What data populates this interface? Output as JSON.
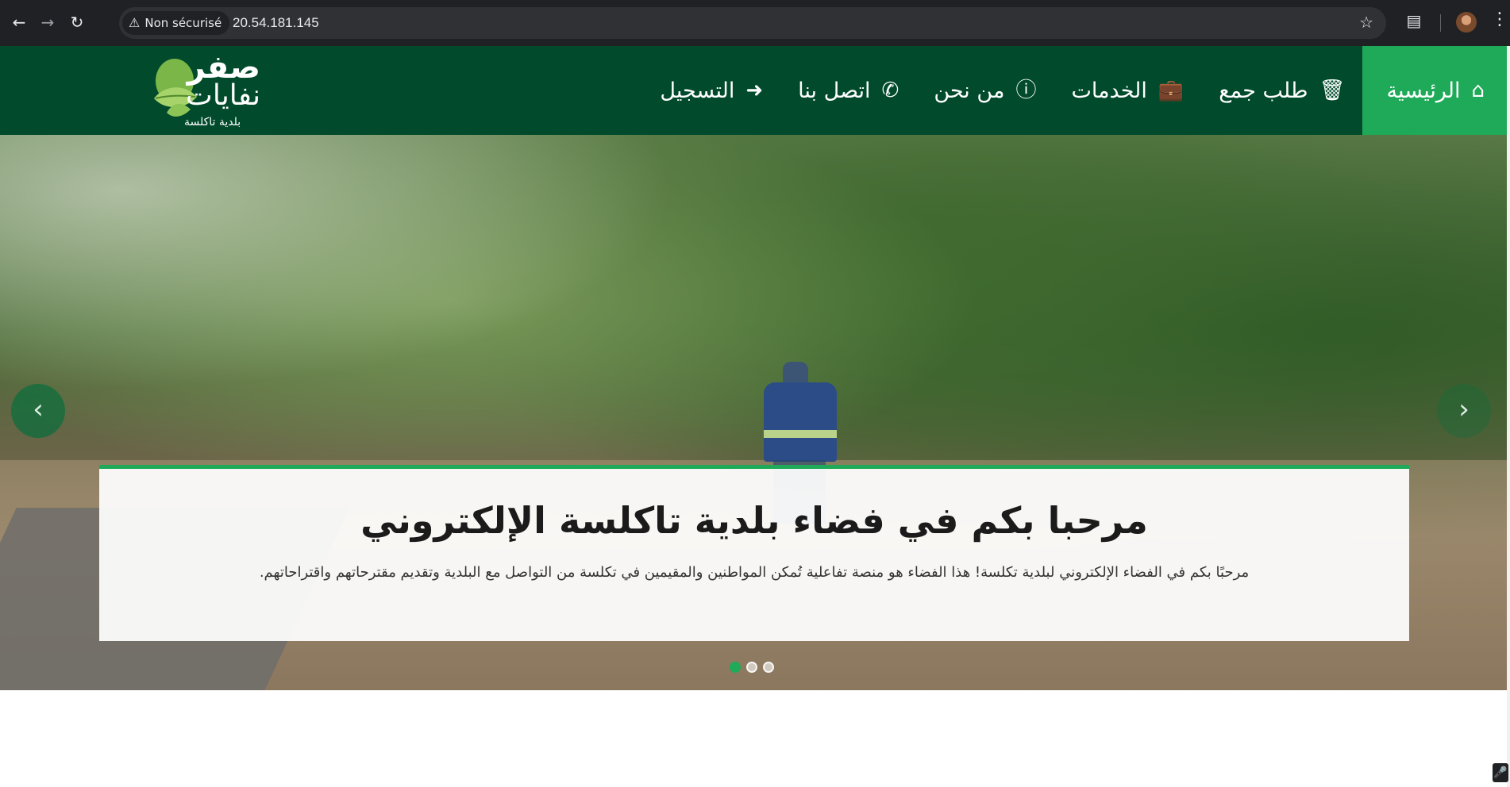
{
  "browser": {
    "security_label": "Non sécurisé",
    "url": "20.54.181.145",
    "icons": [
      "back-icon",
      "forward-icon",
      "reload-icon",
      "warning-icon",
      "star-icon",
      "extensions-icon",
      "avatar",
      "menu-icon"
    ]
  },
  "logo": {
    "line1": "صفر",
    "line2": "نفايات",
    "line3": "بلدية تاكلسة"
  },
  "nav": {
    "items": [
      {
        "label": "الرئيسية",
        "icon": "home-icon",
        "active": true
      },
      {
        "label": "طلب جمع",
        "icon": "trash-icon",
        "active": false
      },
      {
        "label": "الخدمات",
        "icon": "briefcase-icon",
        "active": false
      },
      {
        "label": "من نحن",
        "icon": "info-icon",
        "active": false
      },
      {
        "label": "اتصل بنا",
        "icon": "phone-icon",
        "active": false
      },
      {
        "label": "التسجيل",
        "icon": "sign-in-icon",
        "active": false
      }
    ]
  },
  "hero": {
    "title": "مرحبا بكم في فضاء بلدية تاكلسة الإلكتروني",
    "text": "مرحبًا بكم في الفضاء الإلكتروني لبلدية تكلسة! هذا الفضاء هو منصة تفاعلية تُمكن المواطنين والمقيمين في تكلسة من التواصل مع البلدية وتقديم مقترحاتهم واقتراحاتهم.",
    "slides_count": 3,
    "active_slide": 1
  },
  "colors": {
    "header_bg": "#014a2c",
    "accent": "#1eaa58"
  }
}
